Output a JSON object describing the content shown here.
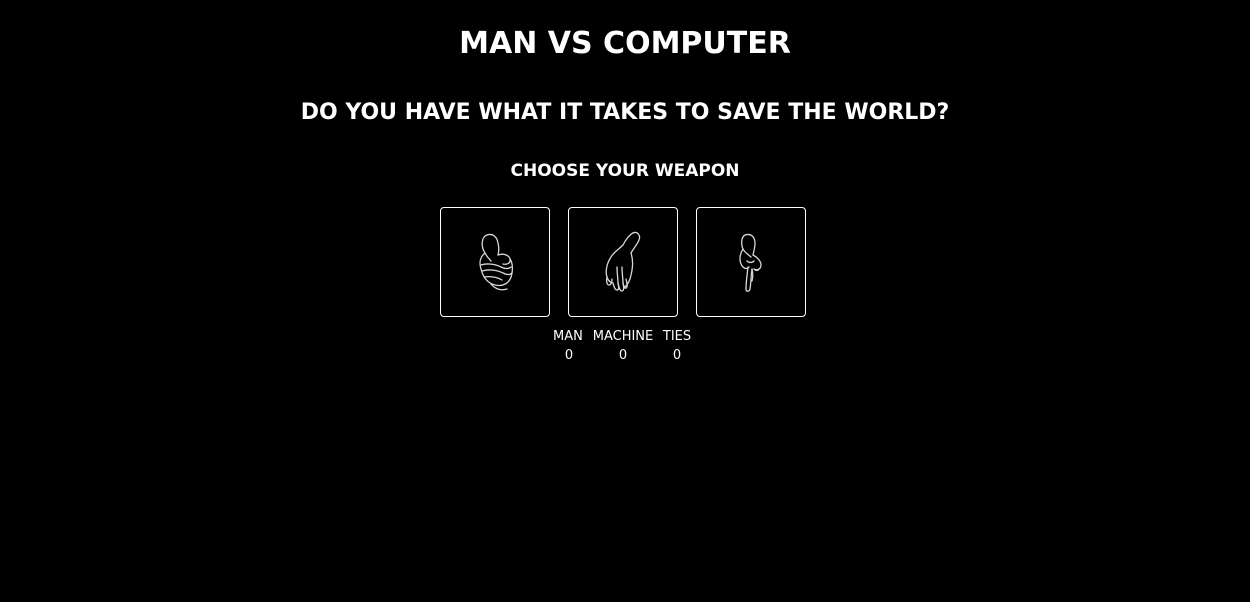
{
  "header": {
    "title": "MAN VS COMPUTER",
    "subtitle": "DO YOU HAVE WHAT IT TAKES TO SAVE THE WORLD?",
    "prompt": "CHOOSE YOUR WEAPON"
  },
  "weapons": [
    {
      "name": "rock",
      "icon": "fist-icon"
    },
    {
      "name": "paper",
      "icon": "open-hand-icon"
    },
    {
      "name": "scissors",
      "icon": "two-fingers-icon"
    }
  ],
  "scoreboard": {
    "man_label": "MAN",
    "machine_label": "MACHINE",
    "ties_label": "TIES",
    "man_score": "0",
    "machine_score": "0",
    "ties_score": "0"
  },
  "colors": {
    "background": "#000000",
    "text": "#ffffff",
    "border": "#ffffff"
  }
}
